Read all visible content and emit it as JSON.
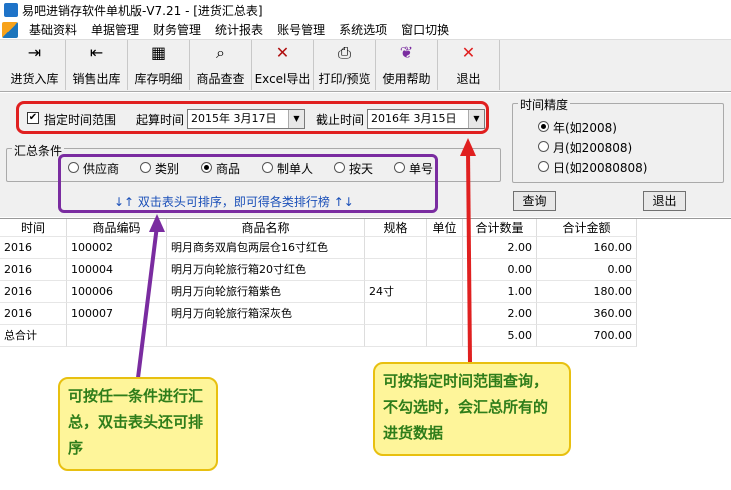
{
  "window": {
    "title": "易吧进销存软件单机版-V7.21 - [进货汇总表]"
  },
  "menu": {
    "items": [
      "基础资料",
      "单据管理",
      "财务管理",
      "统计报表",
      "账号管理",
      "系统选项",
      "窗口切换"
    ]
  },
  "toolbar": {
    "buttons": [
      {
        "label": "进货入库",
        "icon": "import-arrow-icon"
      },
      {
        "label": "销售出库",
        "icon": "export-arrow-icon"
      },
      {
        "label": "库存明细",
        "icon": "inventory-icon"
      },
      {
        "label": "商品查查",
        "icon": "search-goods-icon"
      },
      {
        "label": "Excel导出",
        "icon": "excel-icon"
      },
      {
        "label": "打印/预览",
        "icon": "printer-icon"
      },
      {
        "label": "使用帮助",
        "icon": "help-book-icon"
      },
      {
        "label": "退出",
        "icon": "close-icon"
      }
    ]
  },
  "filter": {
    "range_checkbox_label": "指定时间范围",
    "range_checked": true,
    "start_label": "起算时间",
    "start_value": "2015年 3月17日",
    "end_label": "截止时间",
    "end_value": "2016年 3月15日",
    "group_label": "汇总条件",
    "conditions": [
      "供应商",
      "类别",
      "商品",
      "制单人",
      "按天",
      "单号"
    ],
    "selected_condition": "商品",
    "sort_hint": "↓↑  双击表头可排序，即可得各类排行榜  ↑↓",
    "precision_label": "时间精度",
    "precision_options": [
      "年(如2008)",
      "月(如200808)",
      "日(如20080808)"
    ],
    "selected_precision": "年(如2008)",
    "query_button": "查询",
    "exit_button": "退出"
  },
  "table": {
    "columns": [
      "时间",
      "商品编码",
      "商品名称",
      "规格",
      "单位",
      "合计数量",
      "合计金额"
    ],
    "rows": [
      [
        "2016",
        "100002",
        "明月商务双肩包两层仓16寸红色",
        "",
        "",
        "2.00",
        "160.00"
      ],
      [
        "2016",
        "100004",
        "明月万向轮旅行箱20寸红色",
        "",
        "",
        "0.00",
        "0.00"
      ],
      [
        "2016",
        "100006",
        "明月万向轮旅行箱紫色",
        "24寸",
        "",
        "1.00",
        "180.00"
      ],
      [
        "2016",
        "100007",
        "明月万向轮旅行箱深灰色",
        "",
        "",
        "2.00",
        "360.00"
      ],
      [
        "总合计",
        "",
        "",
        "",
        "",
        "5.00",
        "700.00"
      ]
    ]
  },
  "callouts": {
    "left": "可按任一条件进行汇总，双击表头还可排序",
    "right": "可按指定时间范围查询，不勾选时，会汇总所有的进货数据"
  },
  "colors": {
    "red_highlight": "#e02020",
    "purple_highlight": "#7a2ca0",
    "callout_bg": "#fef59a",
    "callout_text": "#2e7d1a"
  }
}
